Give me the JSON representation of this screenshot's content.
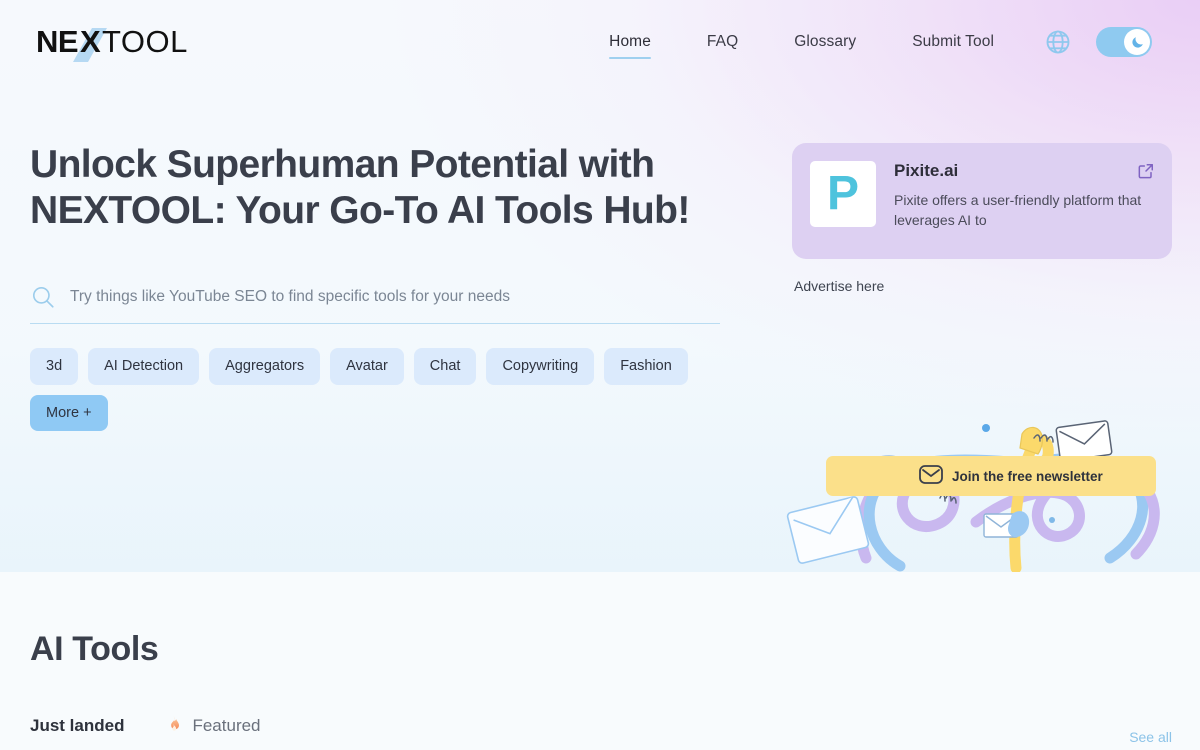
{
  "brand": {
    "logo_part1": "NE",
    "logo_part2": "X",
    "logo_part3": "TOOL"
  },
  "header": {
    "nav": [
      {
        "label": "Home",
        "active": true
      },
      {
        "label": "FAQ",
        "active": false
      },
      {
        "label": "Glossary",
        "active": false
      },
      {
        "label": "Submit Tool",
        "active": false
      }
    ],
    "language_icon": "globe-icon",
    "theme_toggle_icon": "moon-icon",
    "theme_toggle_state": "on",
    "accent_toggle_color": "#8fcaf0"
  },
  "hero": {
    "title": "Unlock Superhuman Potential with NEXTOOL: Your Go-To AI Tools Hub!",
    "search": {
      "icon": "search-icon",
      "placeholder": "Try things like YouTube SEO to find specific tools for your needs",
      "value": ""
    },
    "tags": [
      "3d",
      "AI Detection",
      "Aggregators",
      "Avatar",
      "Chat",
      "Copywriting",
      "Fashion"
    ],
    "more_tag": "More +"
  },
  "ad": {
    "logo_letter": "P",
    "title": "Pixite.ai",
    "description": "Pixite offers a user-friendly platform that leverages AI to",
    "external_icon": "external-link-icon",
    "note": "Advertise here",
    "card_color": "#ddd0f2",
    "logo_color": "#4ec3dd"
  },
  "newsletter": {
    "banner_label": "Join the free newsletter",
    "banner_icon": "envelope-icon",
    "banner_color": "#fbe08a"
  },
  "tools_section": {
    "title": "AI Tools",
    "tabs": [
      {
        "label": "Just landed",
        "icon": "",
        "active": true
      },
      {
        "label": "Featured",
        "icon": "fire-icon",
        "active": false
      }
    ],
    "see_all": "See all"
  }
}
